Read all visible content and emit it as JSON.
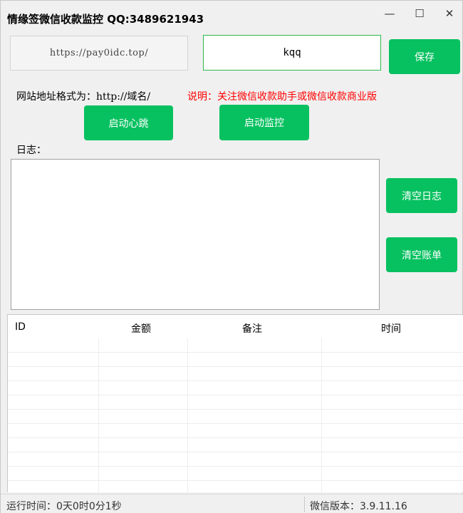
{
  "window": {
    "title": "情缘签微信收款监控  QQ:3489621943",
    "minimize_glyph": "—",
    "maximize_glyph": "☐",
    "close_glyph": "✕"
  },
  "inputs": {
    "url_value": "https://pay0idc.top/",
    "key_value": "kqq"
  },
  "buttons": {
    "save": "保存",
    "start_heartbeat": "启动心跳",
    "start_monitor": "启动监控",
    "clear_log": "清空日志",
    "clear_bill": "清空账单"
  },
  "labels": {
    "format_prefix": "网站地址格式为：",
    "format_url": "http://域名/",
    "note": "说明：关注微信收款助手或微信收款商业版",
    "log": "日志："
  },
  "table": {
    "columns": [
      "ID",
      "金额",
      "备注",
      "时间"
    ],
    "rows": []
  },
  "status": {
    "runtime": "运行时间：0天0时0分1秒",
    "wechat_version": "微信版本：3.9.11.16"
  },
  "colors": {
    "accent_green": "#07c160",
    "input_focus_border": "#2eb84a",
    "note_red": "#ff0000"
  }
}
